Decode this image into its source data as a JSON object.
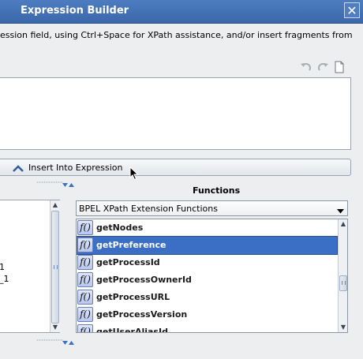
{
  "window": {
    "title": "Expression Builder",
    "close_glyph": "✕"
  },
  "instructions": "ession field, using Ctrl+Space for XPath assistance, and/or insert fragments from",
  "toolbar": {
    "icons": [
      "undo-icon",
      "redo-icon",
      "clear-document-icon"
    ]
  },
  "expression": {
    "value": ""
  },
  "insert_button": {
    "label": "Insert Into Expression"
  },
  "left_panel": {
    "items": [
      "1",
      "_1"
    ]
  },
  "functions": {
    "label": "Functions",
    "category_selected": "BPEL XPath Extension Functions",
    "icon_glyph": "f()",
    "items": [
      {
        "name": "getNodes",
        "selected": false
      },
      {
        "name": "getPreference",
        "selected": true
      },
      {
        "name": "getProcessId",
        "selected": false
      },
      {
        "name": "getProcessOwnerId",
        "selected": false
      },
      {
        "name": "getProcessURL",
        "selected": false
      },
      {
        "name": "getProcessVersion",
        "selected": false
      },
      {
        "name": "getUserAliasId",
        "selected": false
      }
    ]
  },
  "colors": {
    "title_bar": "#3f6eb2",
    "selection": "#3b6fc6",
    "background": "#eceef0"
  }
}
